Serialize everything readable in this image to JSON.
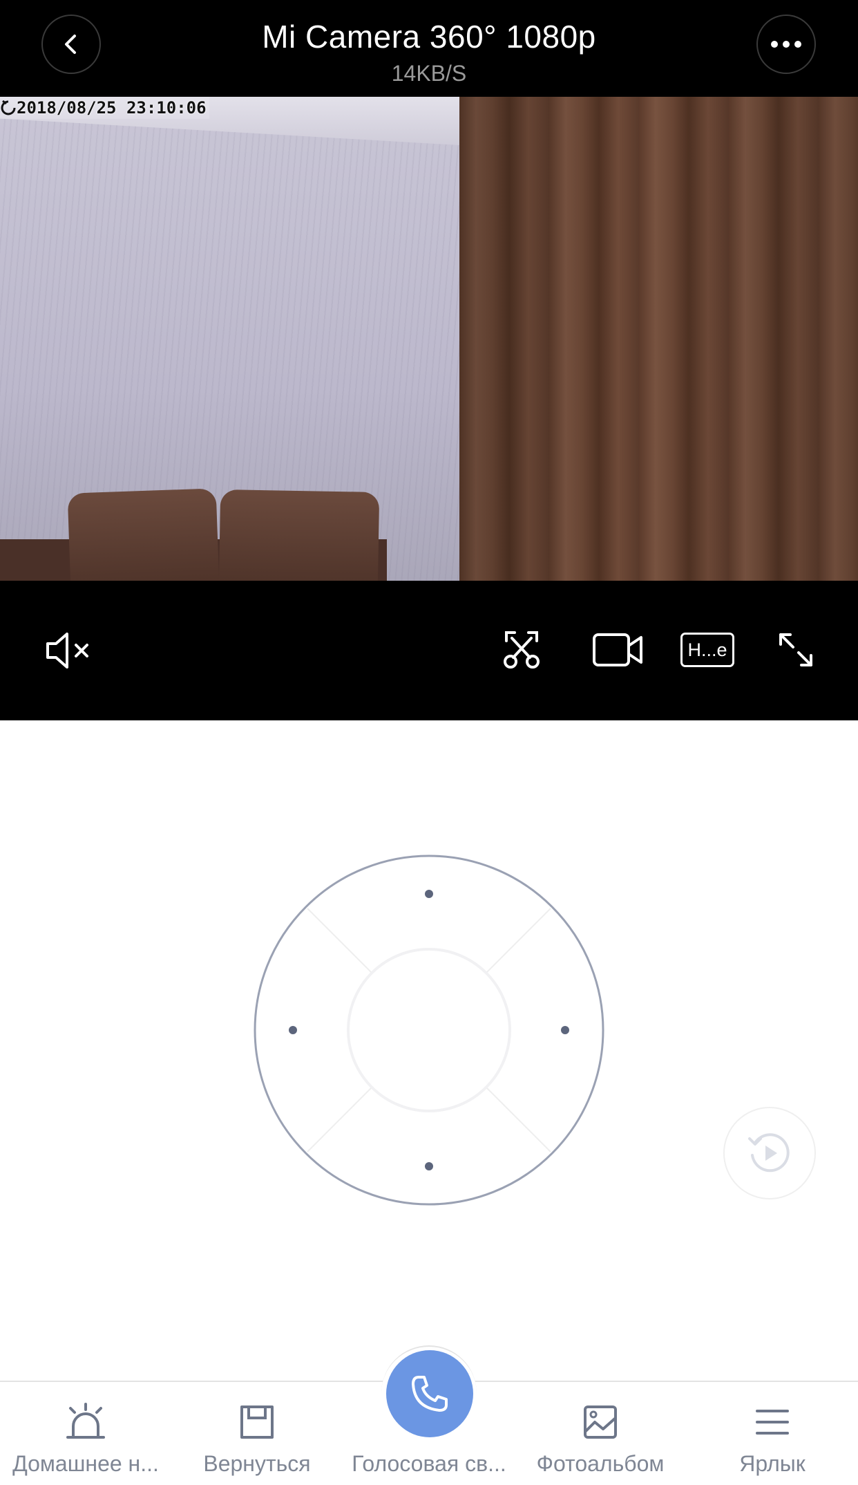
{
  "header": {
    "title": "Mi Camera 360° 1080p",
    "bitrate": "14KB/S",
    "back_icon": "chevron-left-icon",
    "more_icon": "more-horizontal-icon"
  },
  "video": {
    "timestamp": "2018/08/25  23:10:06"
  },
  "controls": {
    "mute_icon": "speaker-muted-icon",
    "screenshot_icon": "scissors-icon",
    "record_icon": "video-camera-icon",
    "quality_label": "H...e",
    "fullscreen_icon": "expand-icon"
  },
  "joystick": {
    "directions": [
      "up",
      "right",
      "down",
      "left"
    ],
    "replay_icon": "replay-icon"
  },
  "bottom_nav": {
    "items": [
      {
        "label": "Домашнее н...",
        "icon": "alarm-light-icon"
      },
      {
        "label": "Вернуться",
        "icon": "floppy-disk-icon"
      },
      {
        "label": "Голосовая св...",
        "icon": "phone-icon"
      },
      {
        "label": "Фотоальбом",
        "icon": "photo-album-icon"
      },
      {
        "label": "Ярлык",
        "icon": "menu-icon"
      }
    ]
  },
  "colors": {
    "accent": "#6b96e3",
    "nav_text": "#7f8694",
    "pad_ring": "#9aa1b3",
    "pad_dot": "#5c657c"
  }
}
